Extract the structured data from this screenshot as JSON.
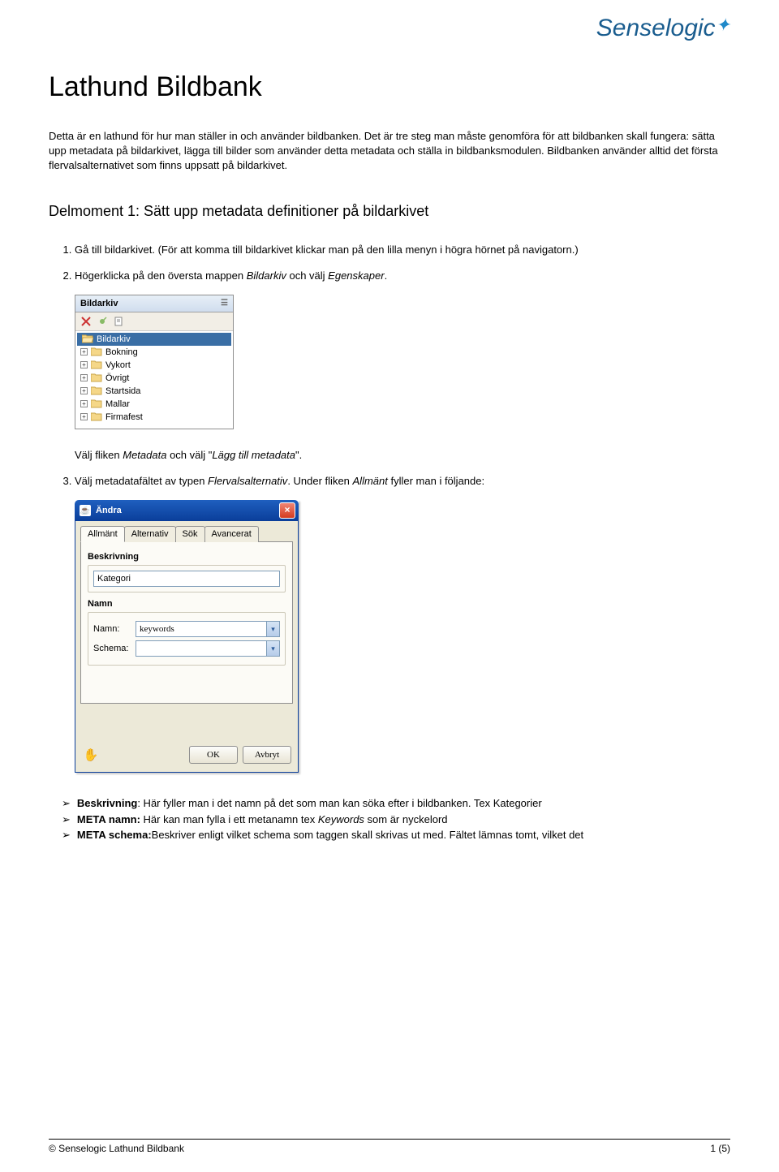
{
  "logo_text": "Senselogic",
  "title": "Lathund Bildbank",
  "intro": "Detta är en lathund för hur man ställer in och använder bildbanken. Det är tre steg man måste genomföra för att bildbanken skall fungera: sätta upp metadata på bildarkivet, lägga till bilder som använder detta metadata och ställa in bildbanksmodulen. Bildbanken använder alltid det första flervalsalternativet som finns uppsatt på bildarkivet.",
  "section_heading": "Delmoment 1: Sätt upp metadata definitioner på bildarkivet",
  "steps": {
    "s1": "Gå till bildarkivet. (För att komma till bildarkivet klickar man på den lilla menyn i högra hörnet på navigatorn.)",
    "s2_pre": "Högerklicka på den översta mappen ",
    "s2_em": "Bildarkiv",
    "s2_mid": " och välj ",
    "s2_em2": "Egenskaper",
    "s2_end": "."
  },
  "panel1": {
    "title": "Bildarkiv",
    "items": [
      "Bildarkiv",
      "Bokning",
      "Vykort",
      "Övrigt",
      "Startsida",
      "Mallar",
      "Firmafest"
    ]
  },
  "after_panel1_pre": "Välj fliken ",
  "after_panel1_em1": "Metadata",
  "after_panel1_mid": " och välj \"",
  "after_panel1_em2": "Lägg till metadata",
  "after_panel1_end": "\".",
  "step3_pre": "Välj metadatafältet av typen ",
  "step3_em": "Flervalsalternativ",
  "step3_mid": ". Under fliken ",
  "step3_em2": "Allmänt",
  "step3_end": " fyller man i följande:",
  "dialog": {
    "title": "Ändra",
    "tabs": [
      "Allmänt",
      "Alternativ",
      "Sök",
      "Avancerat"
    ],
    "beskrivning_label": "Beskrivning",
    "beskrivning_value": "Kategori",
    "namn_section": "Namn",
    "namn_label": "Namn:",
    "namn_value": "keywords",
    "schema_label": "Schema:",
    "schema_value": "",
    "ok": "OK",
    "cancel": "Avbryt"
  },
  "bullets": {
    "b1_bold": "Beskrivning",
    "b1_text": ": Här fyller man i det namn på det som man kan söka efter i bildbanken. Tex Kategorier",
    "b2_bold": "META namn:",
    "b2_text_pre": " Här kan man fylla i ett metanamn tex ",
    "b2_em": "Keywords",
    "b2_text_post": " som är nyckelord",
    "b3_bold": "META schema:",
    "b3_text": "Beskriver enligt vilket schema som taggen skall skrivas ut med. Fältet lämnas tomt, vilket det"
  },
  "footer_left": "© Senselogic Lathund Bildbank",
  "footer_right": "1 (5)"
}
